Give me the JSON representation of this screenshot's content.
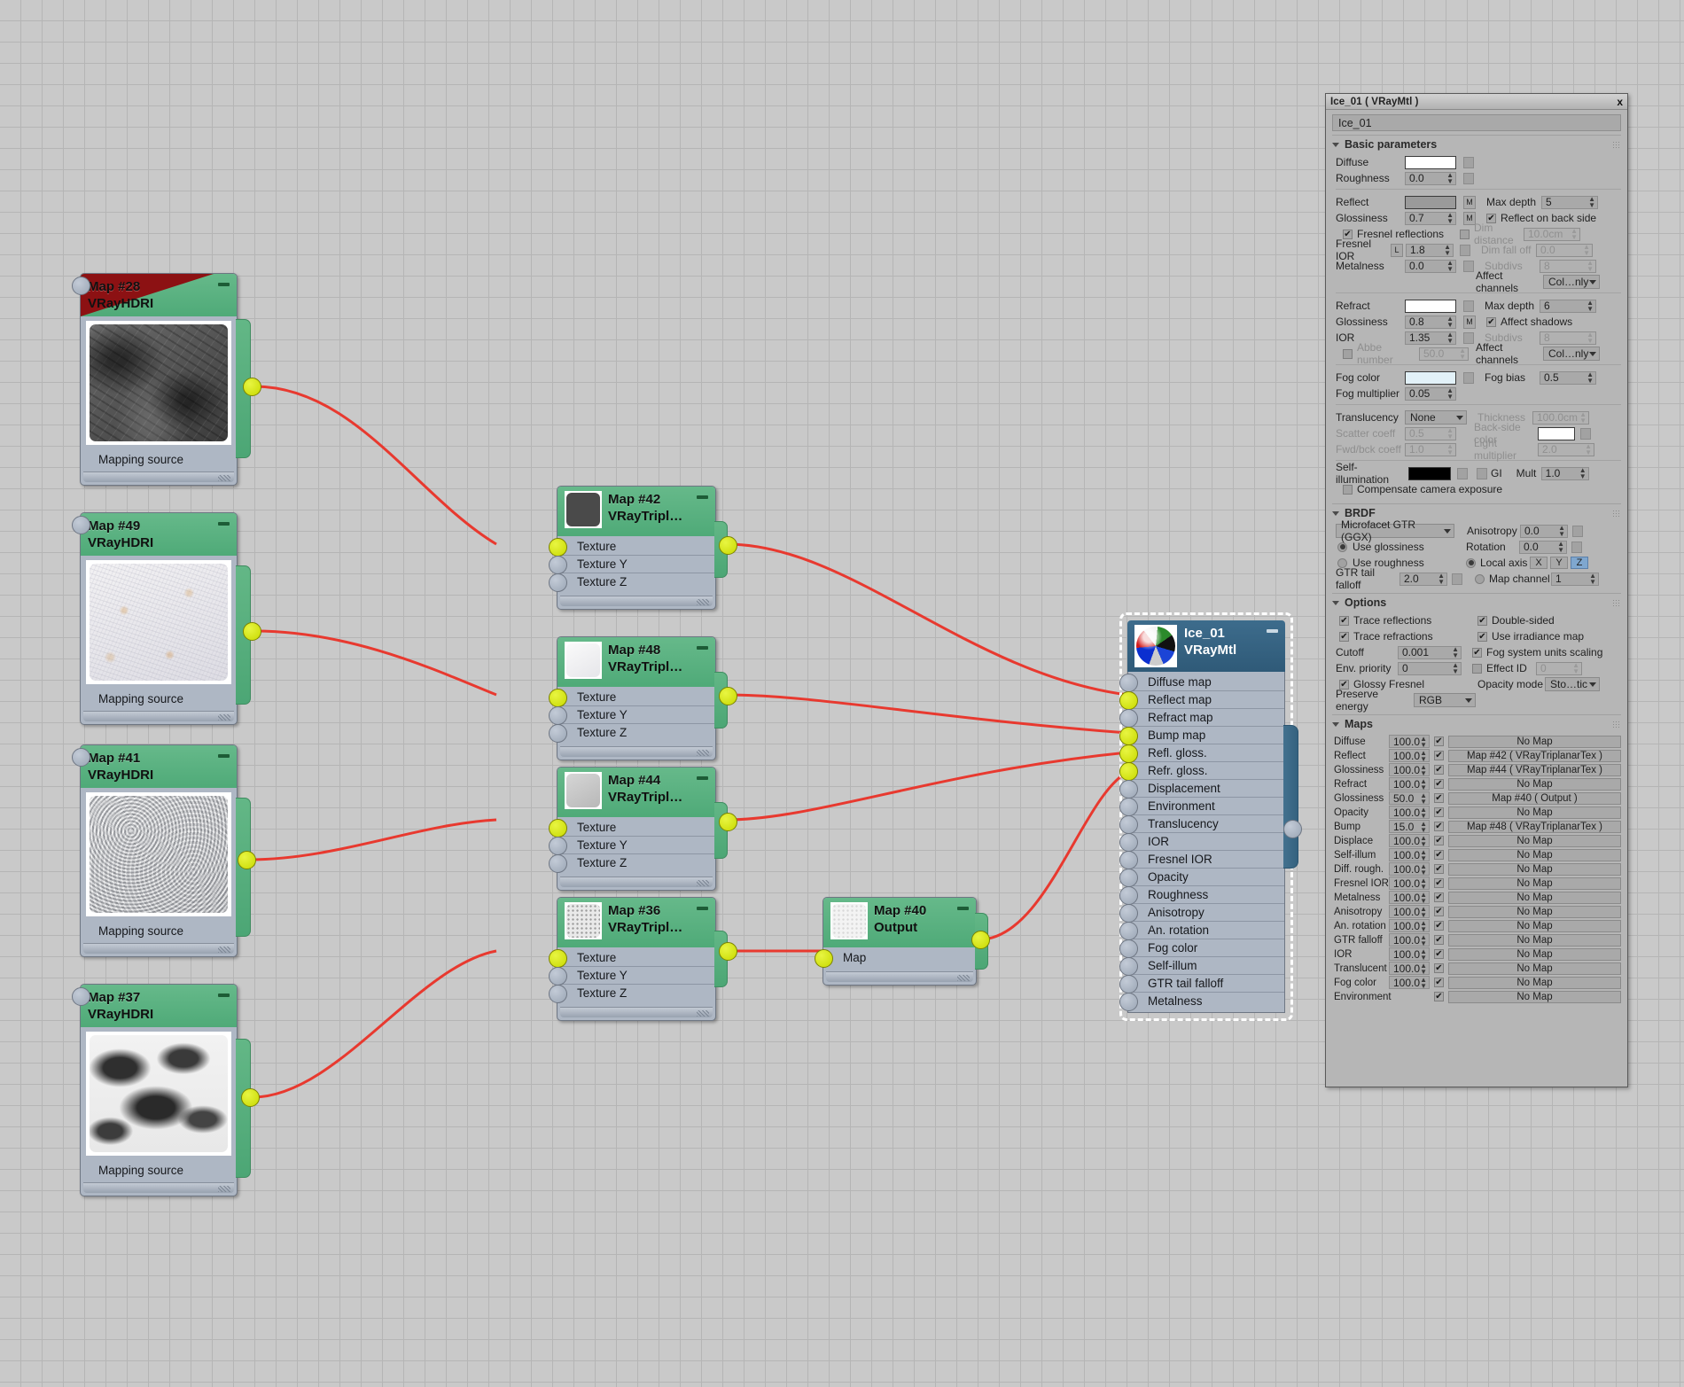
{
  "graph": {
    "hdri_nodes": [
      {
        "id": "map28",
        "title": "Map #28",
        "type": "VRayHDRI",
        "footer": "Mapping source",
        "flagged": true
      },
      {
        "id": "map49",
        "title": "Map #49",
        "type": "VRayHDRI",
        "footer": "Mapping source",
        "flagged": false
      },
      {
        "id": "map41",
        "title": "Map #41",
        "type": "VRayHDRI",
        "footer": "Mapping source",
        "flagged": false
      },
      {
        "id": "map37",
        "title": "Map #37",
        "type": "VRayHDRI",
        "footer": "Mapping source",
        "flagged": false
      }
    ],
    "triplanar_nodes": [
      {
        "id": "map42",
        "title": "Map #42",
        "type": "VRayTripl…",
        "ports": [
          "Texture",
          "Texture Y",
          "Texture Z"
        ]
      },
      {
        "id": "map48",
        "title": "Map #48",
        "type": "VRayTripl…",
        "ports": [
          "Texture",
          "Texture Y",
          "Texture Z"
        ]
      },
      {
        "id": "map44",
        "title": "Map #44",
        "type": "VRayTripl…",
        "ports": [
          "Texture",
          "Texture Y",
          "Texture Z"
        ]
      },
      {
        "id": "map36",
        "title": "Map #36",
        "type": "VRayTripl…",
        "ports": [
          "Texture",
          "Texture Y",
          "Texture Z"
        ]
      }
    ],
    "output_node": {
      "id": "map40",
      "title": "Map #40",
      "type": "Output",
      "ports": [
        "Map"
      ]
    },
    "material_node": {
      "title": "Ice_01",
      "type": "VRayMtl",
      "inputs": [
        {
          "label": "Diffuse map",
          "connected": false
        },
        {
          "label": "Reflect map",
          "connected": true
        },
        {
          "label": "Refract map",
          "connected": false
        },
        {
          "label": "Bump map",
          "connected": true
        },
        {
          "label": "Refl. gloss.",
          "connected": true
        },
        {
          "label": "Refr. gloss.",
          "connected": true
        },
        {
          "label": "Displacement",
          "connected": false
        },
        {
          "label": "Environment",
          "connected": false
        },
        {
          "label": "Translucency",
          "connected": false
        },
        {
          "label": "IOR",
          "connected": false
        },
        {
          "label": "Fresnel IOR",
          "connected": false
        },
        {
          "label": "Opacity",
          "connected": false
        },
        {
          "label": "Roughness",
          "connected": false
        },
        {
          "label": "Anisotropy",
          "connected": false
        },
        {
          "label": "An. rotation",
          "connected": false
        },
        {
          "label": "Fog color",
          "connected": false
        },
        {
          "label": "Self-illum",
          "connected": false
        },
        {
          "label": "GTR tail falloff",
          "connected": false
        },
        {
          "label": "Metalness",
          "connected": false
        }
      ]
    }
  },
  "panel": {
    "titlebar": {
      "title": "Ice_01  ( VRayMtl )",
      "close": "x"
    },
    "name_value": "Ice_01",
    "basic": {
      "header": "Basic parameters",
      "diffuse_label": "Diffuse",
      "diffuse_color": "#ffffff",
      "roughness_label": "Roughness",
      "roughness_value": "0.0",
      "reflect_label": "Reflect",
      "reflect_color": "#9a9a9a",
      "reflect_m": "M",
      "max_depth_label": "Max depth",
      "max_depth_value": "5",
      "glossiness_label": "Glossiness",
      "glossiness_value": "0.7",
      "glossiness_m": "M",
      "reflect_back_label": "Reflect on back side",
      "fresnel_label": "Fresnel reflections",
      "dim_distance_label": "Dim distance",
      "dim_distance_value": "10.0cm",
      "fresnel_ior_label": "Fresnel IOR",
      "fresnel_ior_lock": "L",
      "fresnel_ior_value": "1.8",
      "dim_falloff_label": "Dim fall off",
      "dim_falloff_value": "0.0",
      "metalness_label": "Metalness",
      "metalness_value": "0.0",
      "subdivs_label": "Subdivs",
      "subdivs_value": "8",
      "affect_channels_label": "Affect channels",
      "affect_channels_value": "Col…nly",
      "refract_label": "Refract",
      "refract_color": "#ffffff",
      "refract_max_depth_label": "Max depth",
      "refract_max_depth_value": "6",
      "refract_gloss_label": "Glossiness",
      "refract_gloss_value": "0.8",
      "refract_gloss_m": "M",
      "affect_shadows_label": "Affect shadows",
      "ior_label": "IOR",
      "ior_value": "1.35",
      "refract_subdivs_label": "Subdivs",
      "refract_subdivs_value": "8",
      "abbe_label": "Abbe number",
      "abbe_value": "50.0",
      "refract_affect_channels_label": "Affect channels",
      "refract_affect_channels_value": "Col…nly",
      "fog_color_label": "Fog color",
      "fog_color": "#e2f1f8",
      "fog_bias_label": "Fog bias",
      "fog_bias_value": "0.5",
      "fog_mult_label": "Fog multiplier",
      "fog_mult_value": "0.05",
      "translucency_label": "Translucency",
      "translucency_value": "None",
      "thickness_label": "Thickness",
      "thickness_value": "100.0cm",
      "scatter_label": "Scatter coeff",
      "scatter_value": "0.5",
      "backside_label": "Back-side color",
      "backside_color": "#ffffff",
      "fwdbck_label": "Fwd/bck coeff",
      "fwdbck_value": "1.0",
      "light_mult_label": "Light multiplier",
      "light_mult_value": "2.0",
      "selfillum_label": "Self-illumination",
      "selfillum_color": "#000000",
      "gi_label": "GI",
      "mult_label": "Mult",
      "mult_value": "1.0",
      "compensate_label": "Compensate camera exposure"
    },
    "brdf": {
      "header": "BRDF",
      "model": "Microfacet GTR (GGX)",
      "use_glossiness": "Use glossiness",
      "use_roughness": "Use roughness",
      "gtr_tail_label": "GTR tail falloff",
      "gtr_tail_value": "2.0",
      "anisotropy_label": "Anisotropy",
      "anisotropy_value": "0.0",
      "rotation_label": "Rotation",
      "rotation_value": "0.0",
      "local_axis_label": "Local axis",
      "axis_x": "X",
      "axis_y": "Y",
      "axis_z": "Z",
      "map_channel_label": "Map channel",
      "map_channel_value": "1"
    },
    "options": {
      "header": "Options",
      "trace_reflections": "Trace reflections",
      "trace_refractions": "Trace refractions",
      "cutoff_label": "Cutoff",
      "cutoff_value": "0.001",
      "env_priority_label": "Env. priority",
      "env_priority_value": "0",
      "glossy_fresnel": "Glossy Fresnel",
      "preserve_energy_label": "Preserve energy",
      "preserve_energy_value": "RGB",
      "double_sided": "Double-sided",
      "use_irradiance": "Use irradiance map",
      "fog_units": "Fog system units scaling",
      "effect_id_label": "Effect ID",
      "effect_id_value": "0",
      "opacity_mode_label": "Opacity mode",
      "opacity_mode_value": "Sto…tic"
    },
    "maps": {
      "header": "Maps",
      "rows": [
        {
          "label": "Diffuse",
          "amount": "100.0",
          "enabled": true,
          "map": "No Map"
        },
        {
          "label": "Reflect",
          "amount": "100.0",
          "enabled": true,
          "map": "Map #42  ( VRayTriplanarTex )"
        },
        {
          "label": "Glossiness",
          "amount": "100.0",
          "enabled": true,
          "map": "Map #44  ( VRayTriplanarTex )"
        },
        {
          "label": "Refract",
          "amount": "100.0",
          "enabled": true,
          "map": "No Map"
        },
        {
          "label": "Glossiness",
          "amount": "50.0",
          "enabled": true,
          "map": "Map #40  ( Output )"
        },
        {
          "label": "Opacity",
          "amount": "100.0",
          "enabled": true,
          "map": "No Map"
        },
        {
          "label": "Bump",
          "amount": "15.0",
          "enabled": true,
          "map": "Map #48  ( VRayTriplanarTex )"
        },
        {
          "label": "Displace",
          "amount": "100.0",
          "enabled": true,
          "map": "No Map"
        },
        {
          "label": "Self-illum",
          "amount": "100.0",
          "enabled": true,
          "map": "No Map"
        },
        {
          "label": "Diff. rough.",
          "amount": "100.0",
          "enabled": true,
          "map": "No Map"
        },
        {
          "label": "Fresnel IOR",
          "amount": "100.0",
          "enabled": true,
          "map": "No Map"
        },
        {
          "label": "Metalness",
          "amount": "100.0",
          "enabled": true,
          "map": "No Map"
        },
        {
          "label": "Anisotropy",
          "amount": "100.0",
          "enabled": true,
          "map": "No Map"
        },
        {
          "label": "An. rotation",
          "amount": "100.0",
          "enabled": true,
          "map": "No Map"
        },
        {
          "label": "GTR falloff",
          "amount": "100.0",
          "enabled": true,
          "map": "No Map"
        },
        {
          "label": "IOR",
          "amount": "100.0",
          "enabled": true,
          "map": "No Map"
        },
        {
          "label": "Translucent",
          "amount": "100.0",
          "enabled": true,
          "map": "No Map"
        },
        {
          "label": "Fog color",
          "amount": "100.0",
          "enabled": true,
          "map": "No Map"
        },
        {
          "label": "Environment",
          "amount": "",
          "enabled": true,
          "map": "No Map"
        }
      ]
    }
  },
  "colors": {
    "node_green": "#4faa78",
    "node_body": "#aeb7c4",
    "mtl_blue": "#2f5a78",
    "wire_red": "#e8392f",
    "socket_yellow": "#d8e800",
    "flag_red": "#8c1113",
    "canvas": "#c9c9c9"
  }
}
